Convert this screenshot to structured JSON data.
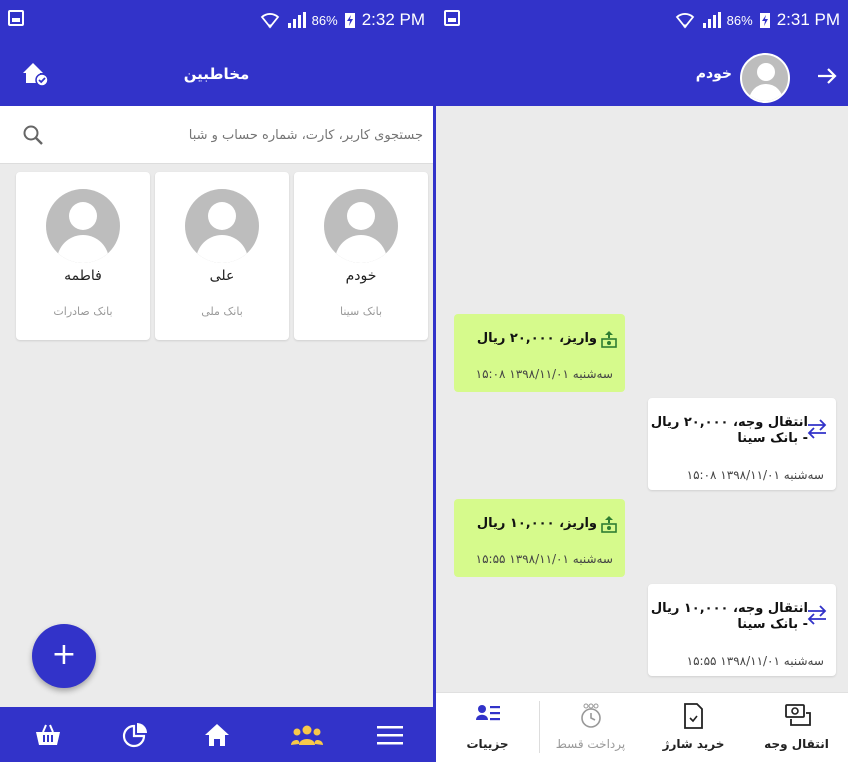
{
  "contacts_screen": {
    "status": {
      "battery": "86%",
      "time": "2:32 PM"
    },
    "title": "مخاطبین",
    "search_placeholder": "جستجوی کاربر، کارت، شماره حساب و شبا",
    "contacts": [
      {
        "name": "خودم",
        "bank": "بانک سینا"
      },
      {
        "name": "علی",
        "bank": "بانک ملی"
      },
      {
        "name": "فاطمه",
        "bank": "بانک صادرات"
      }
    ],
    "fab_label": "+",
    "bottom_nav": [
      "basket-icon",
      "chart-icon",
      "home-icon",
      "contacts-icon",
      "menu-icon"
    ],
    "active_nav": "contacts-icon",
    "colors": {
      "primary": "#3233c9",
      "active_nav": "#f7c84a"
    }
  },
  "chat_screen": {
    "status": {
      "battery": "86%",
      "time": "2:31 PM"
    },
    "contact_name": "خودم",
    "messages": [
      {
        "type": "in",
        "title": "واریز، ۲۰,۰۰۰ ریال",
        "time": "سه‌شنبه ۱۳۹۸/۱۱/۰۱ ۱۵:۰۸"
      },
      {
        "type": "out",
        "title_line1": "انتقال وجه، ۲۰,۰۰۰ ریال",
        "title_line2": "- بانک سینا",
        "time": "سه‌شنبه ۱۳۹۸/۱۱/۰۱ ۱۵:۰۸"
      },
      {
        "type": "in",
        "title": "واریز، ۱۰,۰۰۰ ریال",
        "time": "سه‌شنبه ۱۳۹۸/۱۱/۰۱ ۱۵:۵۵"
      },
      {
        "type": "out",
        "title_line1": "انتقال وجه، ۱۰,۰۰۰ ریال",
        "title_line2": "- بانک سینا",
        "time": "سه‌شنبه ۱۳۹۸/۱۱/۰۱ ۱۵:۵۵"
      }
    ],
    "tabs": [
      {
        "label": "جزییات",
        "icon": "details-icon",
        "enabled": true
      },
      {
        "label": "پرداخت قسط",
        "icon": "installment-icon",
        "enabled": false
      },
      {
        "label": "خرید شارژ",
        "icon": "sim-card-icon",
        "enabled": true
      },
      {
        "label": "انتقال وجه",
        "icon": "money-transfer-icon",
        "enabled": true
      }
    ],
    "colors": {
      "incoming_bubble": "#d6fa8c",
      "outgoing_bubble": "#ffffff",
      "transfer_arrow": "#3233c9"
    }
  }
}
